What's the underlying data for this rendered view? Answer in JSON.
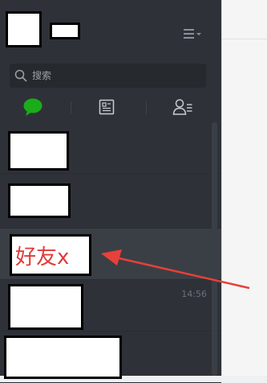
{
  "header": {
    "menu_icon": "menu-lines-icon"
  },
  "search": {
    "placeholder": "搜索",
    "icon": "search-icon"
  },
  "tabs": [
    {
      "id": "chats",
      "icon": "chat-bubble-icon",
      "active": true,
      "color": "#1aad19"
    },
    {
      "id": "public",
      "icon": "document-icon",
      "active": false
    },
    {
      "id": "contacts",
      "icon": "contacts-icon",
      "active": false
    }
  ],
  "conversations": [
    {
      "time": ""
    },
    {
      "time": ""
    },
    {
      "label": "好友x",
      "time": "",
      "selected": true
    },
    {
      "time": "14:56"
    },
    {
      "time": ""
    }
  ],
  "annotation": {
    "color": "#e8403a"
  },
  "colors": {
    "sidebar_bg": "#2e3238",
    "search_bg": "#26292e",
    "selected_row": "#3a3f45",
    "main_bg": "#f5f5f5",
    "label_text": "#e03a3a"
  }
}
